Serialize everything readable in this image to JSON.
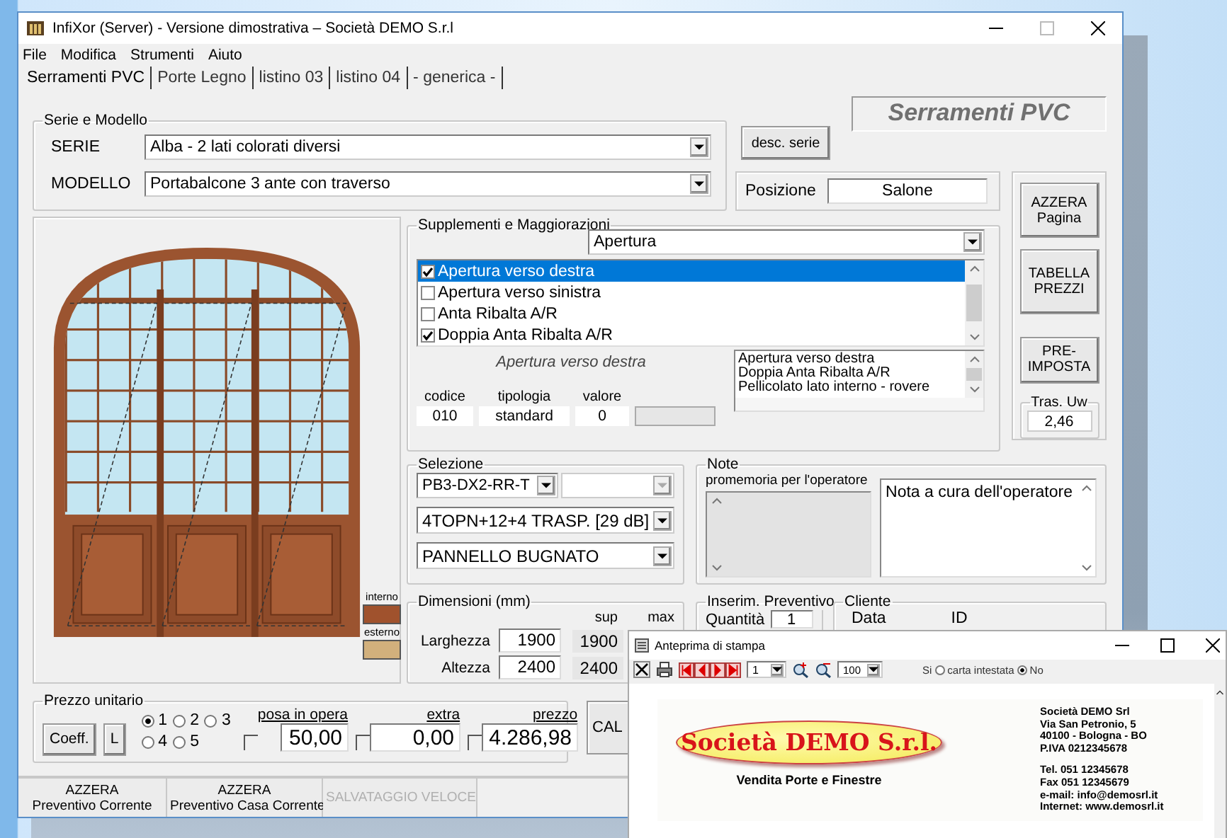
{
  "window": {
    "title": "InfiXor (Server) - Versione dimostrativa – Società DEMO S.r.l"
  },
  "menu": [
    "File",
    "Modifica",
    "Strumenti",
    "Aiuto"
  ],
  "tabs": [
    {
      "label": "Serramenti PVC",
      "selected": true
    },
    {
      "label": "Porte Legno",
      "selected": false
    },
    {
      "label": "listino 03",
      "selected": false
    },
    {
      "label": "listino 04",
      "selected": false
    },
    {
      "label": "- generica -",
      "selected": false
    }
  ],
  "header_title": "Serramenti PVC",
  "serie_modello": {
    "legend": "Serie e Modello",
    "fields": [
      {
        "label": "SERIE",
        "value": "Alba - 2 lati colorati diversi"
      },
      {
        "label": "MODELLO",
        "value": "Portabalcone 3 ante con traverso"
      }
    ]
  },
  "desc_button": "desc. serie",
  "posizione": {
    "label": "Posizione",
    "value": "Salone"
  },
  "side_buttons": [
    "AZZERA\nPagina",
    "TABELLA\nPREZZI",
    "PRE-\nIMPOSTA"
  ],
  "tras_uw": {
    "legend": "Tras. Uw",
    "value": "2,46"
  },
  "colors": [
    {
      "label": "interno",
      "color": "#a0522d"
    },
    {
      "label": "esterno",
      "color": "#d2b07c"
    }
  ],
  "supplementi": {
    "legend": "Supplementi e Maggiorazioni",
    "category": "Apertura",
    "items": [
      {
        "label": "Apertura verso destra",
        "checked": true,
        "selected": true
      },
      {
        "label": "Apertura verso sinistra",
        "checked": false,
        "selected": false
      },
      {
        "label": "Anta Ribalta A/R",
        "checked": false,
        "selected": false
      },
      {
        "label": "Doppia Anta Ribalta A/R",
        "checked": true,
        "selected": false
      }
    ],
    "description": "Apertura verso destra",
    "details": [
      {
        "label": "codice",
        "value": "010"
      },
      {
        "label": "tipologia",
        "value": "standard"
      },
      {
        "label": "valore",
        "value": "0"
      }
    ],
    "summary": [
      "Apertura verso destra",
      "Doppia Anta Ribalta A/R",
      "Pellicolato lato interno - rovere"
    ]
  },
  "selezione": {
    "legend": "Selezione",
    "code": "PB3-DX2-RR-T",
    "glass": "4TOPN+12+4 TRASP.  [29 dB]",
    "panel": "PANNELLO BUGNATO"
  },
  "note": {
    "legend": "Note",
    "memo_label": "promemoria per l'operatore",
    "text": "Nota a cura dell'operatore"
  },
  "dimensioni": {
    "legend": "Dimensioni (mm)",
    "columns": [
      "sup",
      "max"
    ],
    "rows": [
      {
        "label": "Larghezza",
        "value": "1900",
        "sup": "1900"
      },
      {
        "label": "Altezza",
        "value": "2400",
        "sup": "2400"
      }
    ]
  },
  "inserim": {
    "legend": "Inserim. Preventivo",
    "quantity_label": "Quantità",
    "quantity": "1"
  },
  "cliente": {
    "legend": "Cliente",
    "columns": [
      "Data",
      "ID"
    ]
  },
  "prezzo": {
    "legend": "Prezzo unitario",
    "buttons": [
      "Coeff.",
      "L"
    ],
    "options": [
      {
        "label": "1",
        "selected": true
      },
      {
        "label": "2",
        "selected": false
      },
      {
        "label": "3",
        "selected": false
      },
      {
        "label": "4",
        "selected": false
      },
      {
        "label": "5",
        "selected": false
      }
    ],
    "fields": [
      {
        "label": "posa in opera",
        "value": "50,00",
        "checked": false
      },
      {
        "label": "extra",
        "value": "0,00",
        "checked": false
      },
      {
        "label": "prezzo",
        "value": "4.286,98",
        "checked": false
      }
    ]
  },
  "calc_button": "CAL",
  "bottom_buttons": [
    {
      "label": "AZZERA\nPreventivo Corrente",
      "disabled": false
    },
    {
      "label": "AZZERA\nPreventivo Casa Corrente",
      "disabled": false
    },
    {
      "label": "SALVATAGGIO VELOCE",
      "disabled": true
    }
  ],
  "preview": {
    "title": "Anteprima di stampa",
    "page": "1",
    "zoom": "100",
    "letterhead": {
      "label": "carta intestata",
      "options": [
        {
          "label": "Si",
          "selected": false
        },
        {
          "label": "No",
          "selected": true
        }
      ]
    },
    "logo": "Società DEMO S.r.l.",
    "tagline": "Vendita Porte e Finestre",
    "address": [
      "Società DEMO Srl",
      "Via San Petronio, 5",
      "40100 - Bologna - BO",
      "P.IVA 0212345678"
    ],
    "contacts": [
      "Tel. 051 12345678",
      "Fax 051 12345679",
      "e-mail: info@demosrl.it",
      "Internet: www.demosrl.it"
    ]
  }
}
